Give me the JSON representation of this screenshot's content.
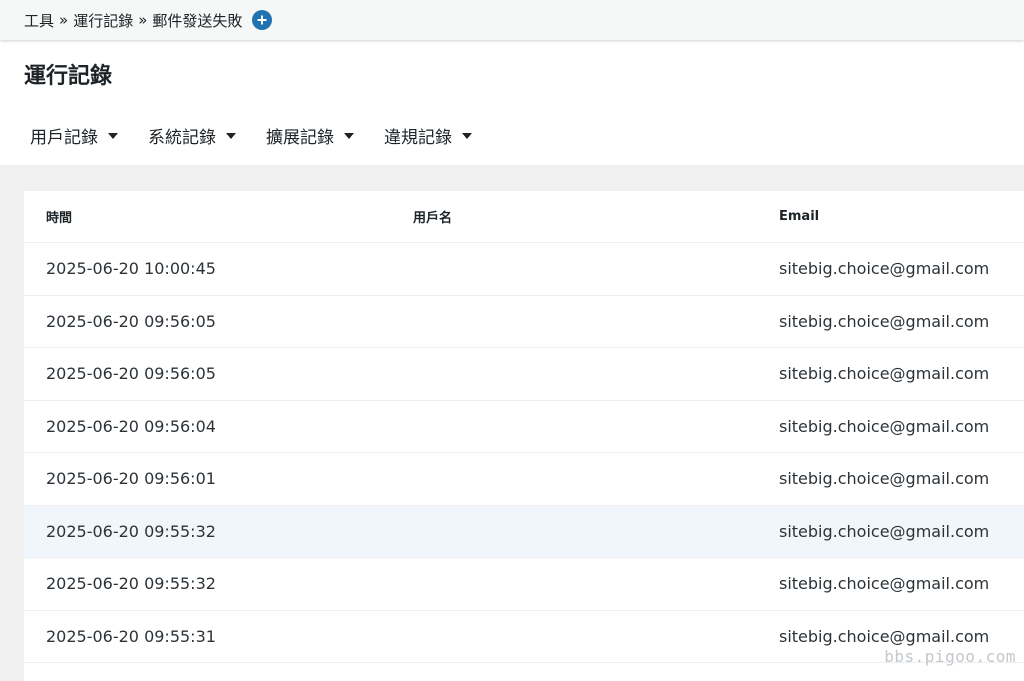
{
  "breadcrumb": {
    "items": [
      "工具",
      "運行記錄",
      "郵件發送失敗"
    ],
    "separator": "»"
  },
  "page": {
    "title": "運行記錄"
  },
  "tabs": [
    {
      "label": "用戶記錄"
    },
    {
      "label": "系統記錄"
    },
    {
      "label": "擴展記錄"
    },
    {
      "label": "違規記錄"
    }
  ],
  "table": {
    "columns": [
      "時間",
      "用戶名",
      "Email"
    ],
    "rows": [
      {
        "time": "2025-06-20 10:00:45",
        "username": "",
        "email": "sitebig.choice@gmail.com"
      },
      {
        "time": "2025-06-20 09:56:05",
        "username": "",
        "email": "sitebig.choice@gmail.com"
      },
      {
        "time": "2025-06-20 09:56:05",
        "username": "",
        "email": "sitebig.choice@gmail.com"
      },
      {
        "time": "2025-06-20 09:56:04",
        "username": "",
        "email": "sitebig.choice@gmail.com"
      },
      {
        "time": "2025-06-20 09:56:01",
        "username": "",
        "email": "sitebig.choice@gmail.com"
      },
      {
        "time": "2025-06-20 09:55:32",
        "username": "",
        "email": "sitebig.choice@gmail.com"
      },
      {
        "time": "2025-06-20 09:55:32",
        "username": "",
        "email": "sitebig.choice@gmail.com"
      },
      {
        "time": "2025-06-20 09:55:31",
        "username": "",
        "email": "sitebig.choice@gmail.com"
      }
    ]
  },
  "watermark": "bbs.pigoo.com",
  "colors": {
    "accent": "#2271b1",
    "row_highlight": "#f0f6fc",
    "background": "#f0f0f1"
  },
  "icons": {
    "add": "plus-circle-icon",
    "dropdown": "caret-down-icon"
  }
}
